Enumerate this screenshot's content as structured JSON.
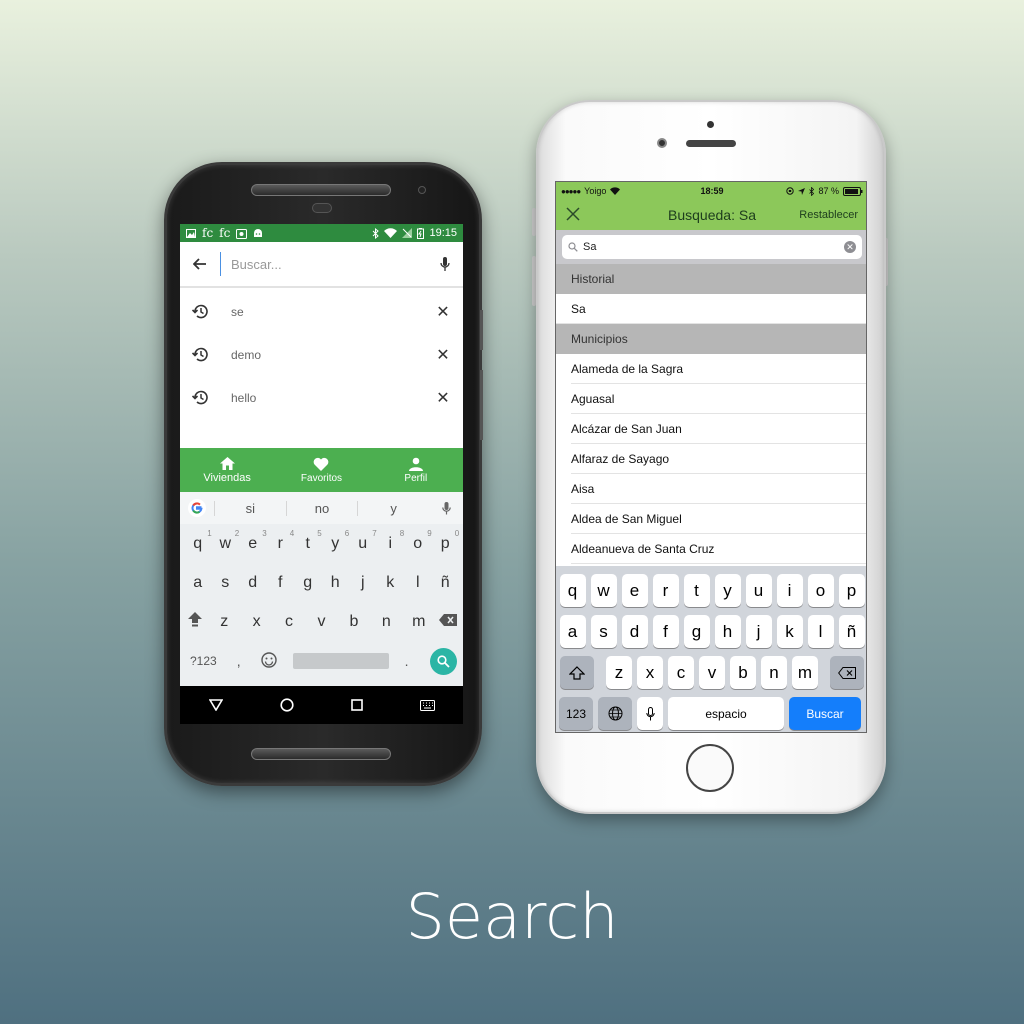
{
  "caption": "Search",
  "android": {
    "status_time": "19:15",
    "status_left_icons": [
      "image-icon",
      "fc",
      "fc",
      "photo-icon",
      "android-icon"
    ],
    "search_placeholder": "Buscar...",
    "history": [
      {
        "text": "se"
      },
      {
        "text": "demo"
      },
      {
        "text": "hello"
      }
    ],
    "bottom_nav": [
      {
        "label": "Viviendas",
        "icon": "home-icon"
      },
      {
        "label": "Favoritos",
        "icon": "heart-icon"
      },
      {
        "label": "Perfil",
        "icon": "person-icon"
      }
    ],
    "keyboard": {
      "suggestions": [
        "si",
        "no",
        "y"
      ],
      "row1": [
        "q",
        "w",
        "e",
        "r",
        "t",
        "y",
        "u",
        "i",
        "o",
        "p"
      ],
      "row1_hints": [
        "1",
        "2",
        "3",
        "4",
        "5",
        "6",
        "7",
        "8",
        "9",
        "0"
      ],
      "row2": [
        "a",
        "s",
        "d",
        "f",
        "g",
        "h",
        "j",
        "k",
        "l",
        "ñ"
      ],
      "row3": [
        "z",
        "x",
        "c",
        "v",
        "b",
        "n",
        "m"
      ],
      "num_label": "?123",
      "comma": ",",
      "period": "."
    }
  },
  "ios": {
    "carrier": "Yoigo",
    "time": "18:59",
    "battery": "87 %",
    "nav_title": "Busqueda: Sa",
    "reset_label": "Restablecer",
    "search_value": "Sa",
    "sections": [
      {
        "title": "Historial",
        "items": [
          "Sa"
        ]
      },
      {
        "title": "Municipios",
        "items": [
          "Alameda de la Sagra",
          "Aguasal",
          "Alcázar de San Juan",
          "Alfaraz de Sayago",
          "Aisa",
          "Aldea de San Miguel",
          "Aldeanueva de Santa Cruz"
        ]
      }
    ],
    "keyboard": {
      "row1": [
        "q",
        "w",
        "e",
        "r",
        "t",
        "y",
        "u",
        "i",
        "o",
        "p"
      ],
      "row2": [
        "a",
        "s",
        "d",
        "f",
        "g",
        "h",
        "j",
        "k",
        "l",
        "ñ"
      ],
      "row3": [
        "z",
        "x",
        "c",
        "v",
        "b",
        "n",
        "m"
      ],
      "num_label": "123",
      "space_label": "espacio",
      "go_label": "Buscar"
    }
  }
}
